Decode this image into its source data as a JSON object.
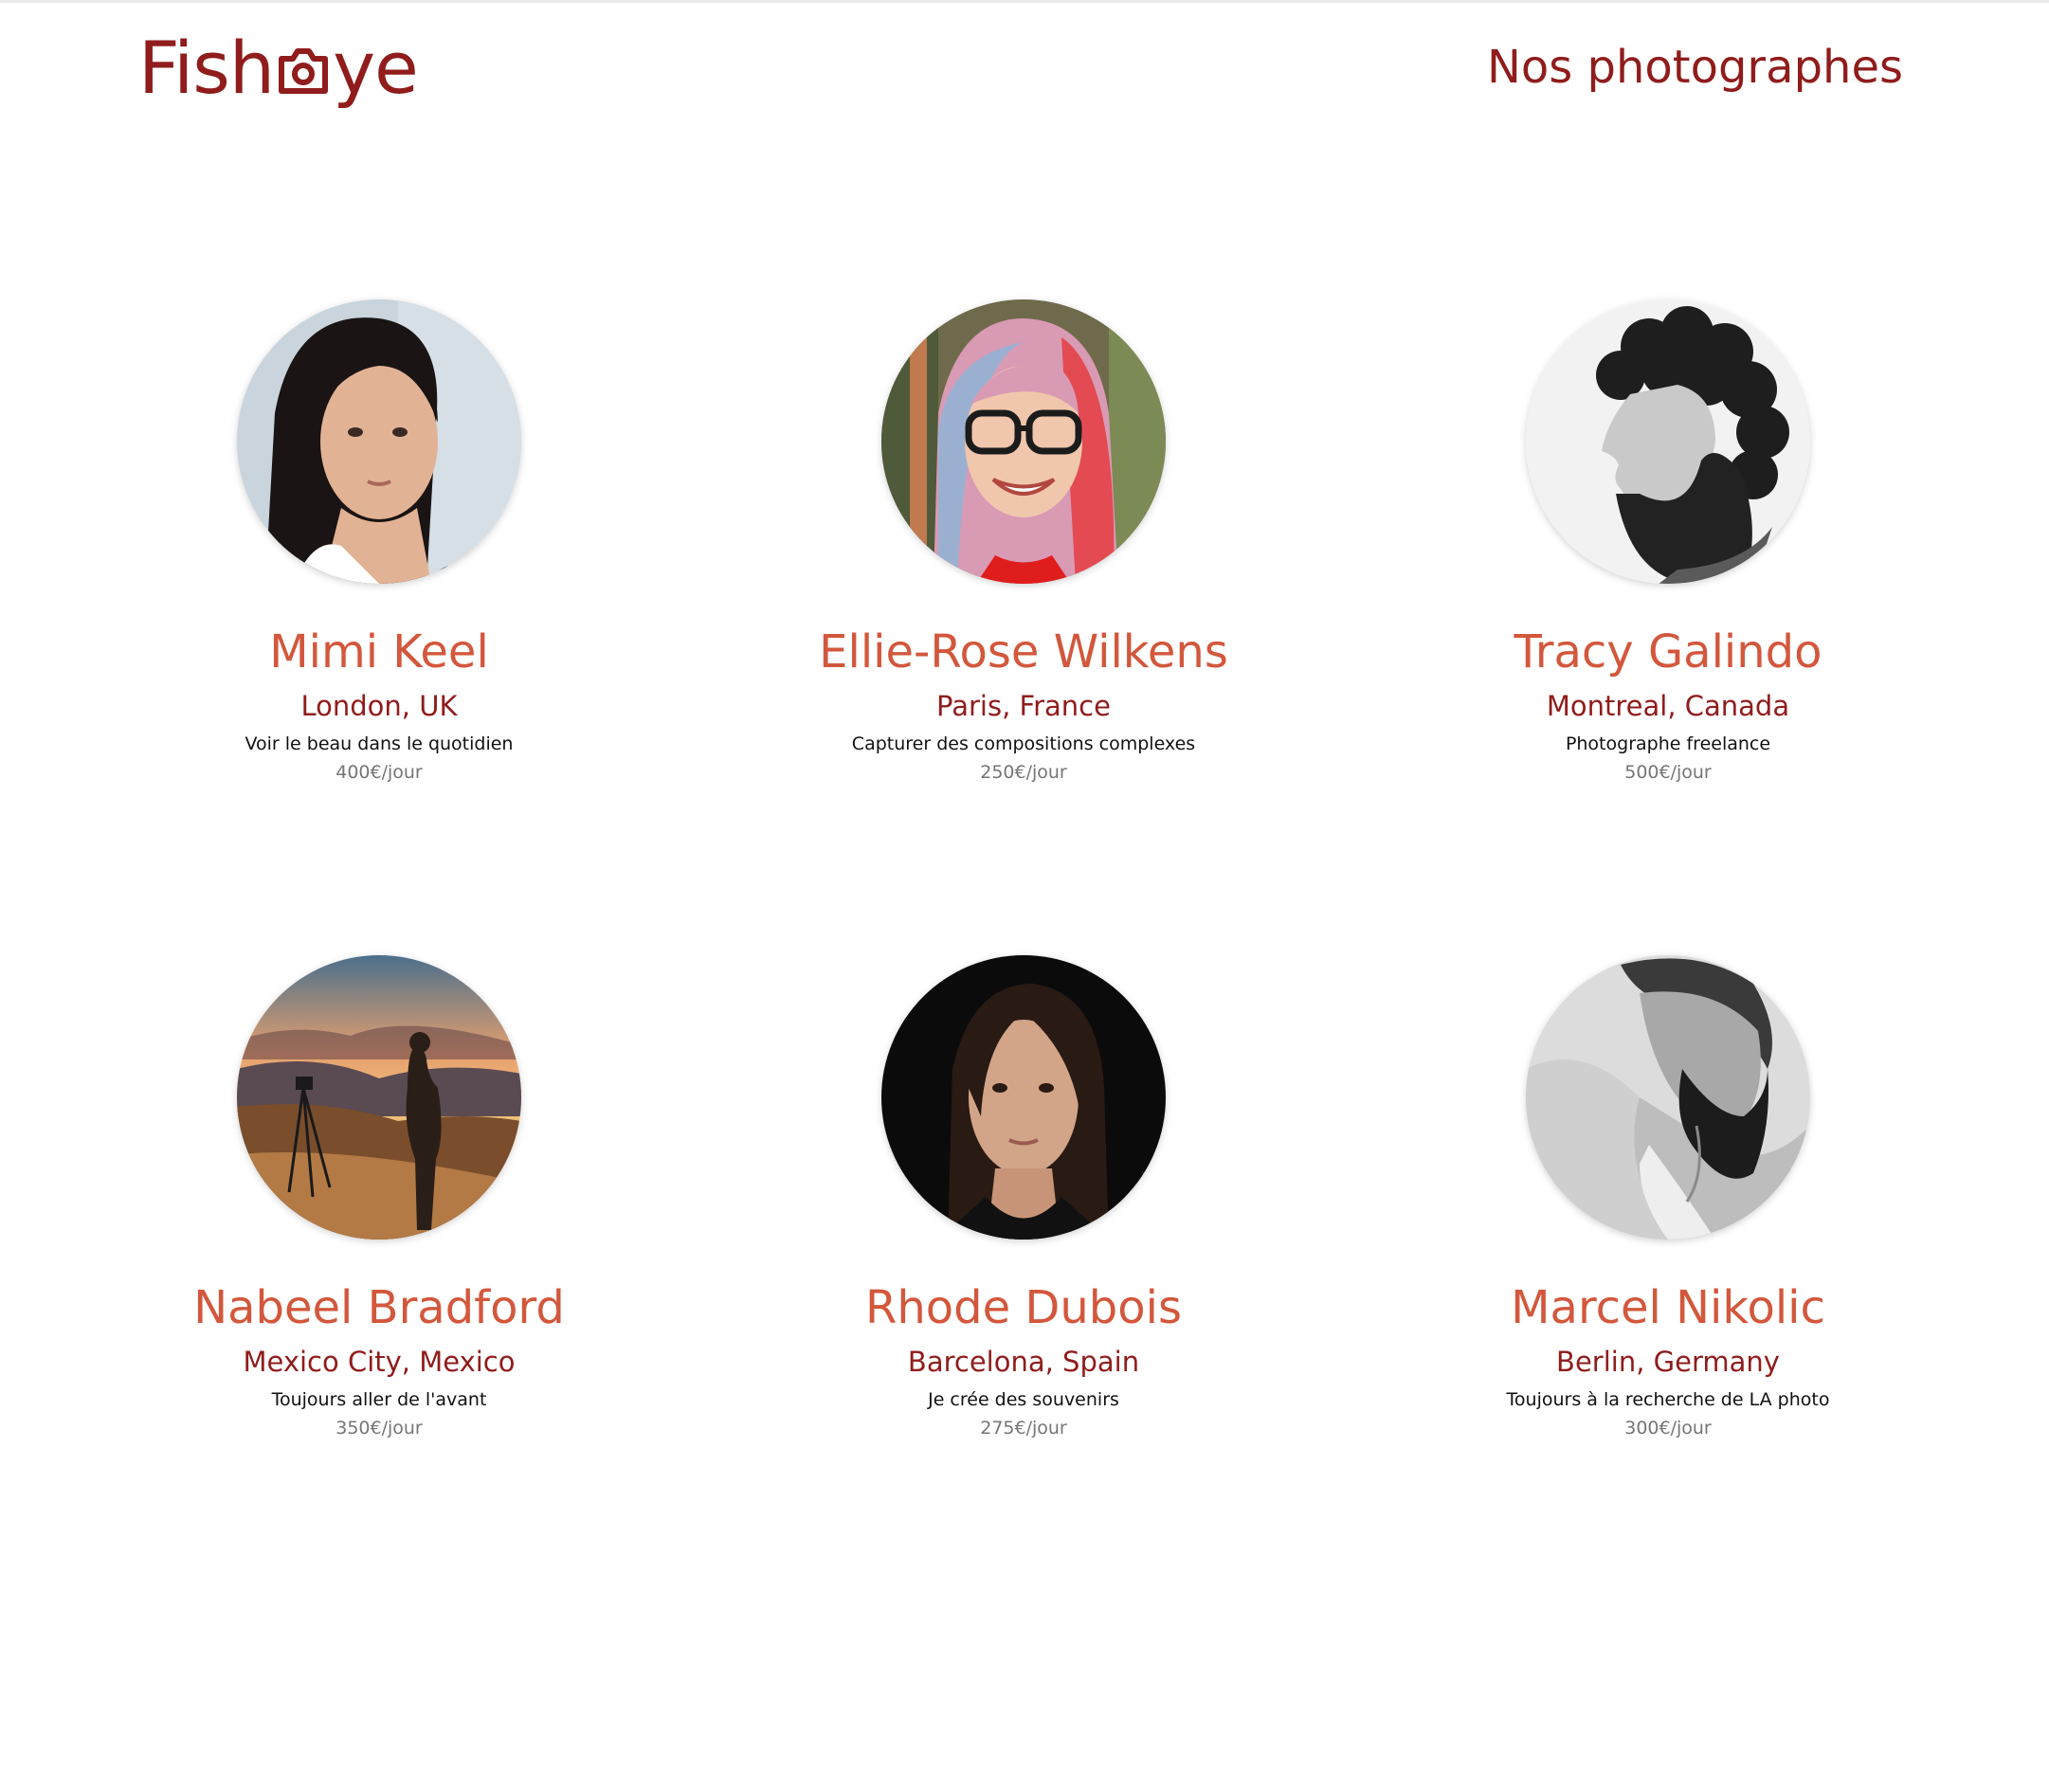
{
  "header": {
    "logo_text_left": "Fish",
    "logo_text_right": "ye",
    "logo_icon": "camera-icon",
    "title": "Nos photographes"
  },
  "colors": {
    "brand_dark": "#901c1c",
    "name_color": "#d3573c",
    "tagline_color": "#111111",
    "price_color": "#757575"
  },
  "photographers": [
    {
      "name": "Mimi Keel",
      "location": "London, UK",
      "tagline": "Voir le beau dans le quotidien",
      "price": "400€/jour",
      "portrait": "woman-dark-hair-portrait"
    },
    {
      "name": "Ellie-Rose Wilkens",
      "location": "Paris, France",
      "tagline": "Capturer des compositions complexes",
      "price": "250€/jour",
      "portrait": "woman-glasses-pink-hair-portrait"
    },
    {
      "name": "Tracy Galindo",
      "location": "Montreal, Canada",
      "tagline": "Photographe freelance",
      "price": "500€/jour",
      "portrait": "man-curly-hair-bw-portrait"
    },
    {
      "name": "Nabeel Bradford",
      "location": "Mexico City, Mexico",
      "tagline": "Toujours aller de l'avant",
      "price": "350€/jour",
      "portrait": "photographer-sunset-landscape"
    },
    {
      "name": "Rhode Dubois",
      "location": "Barcelona, Spain",
      "tagline": "Je crée des souvenirs",
      "price": "275€/jour",
      "portrait": "woman-dark-background-portrait"
    },
    {
      "name": "Marcel Nikolic",
      "location": "Berlin, Germany",
      "tagline": "Toujours à la recherche de LA photo",
      "price": "300€/jour",
      "portrait": "bearded-man-bw-portrait"
    }
  ]
}
